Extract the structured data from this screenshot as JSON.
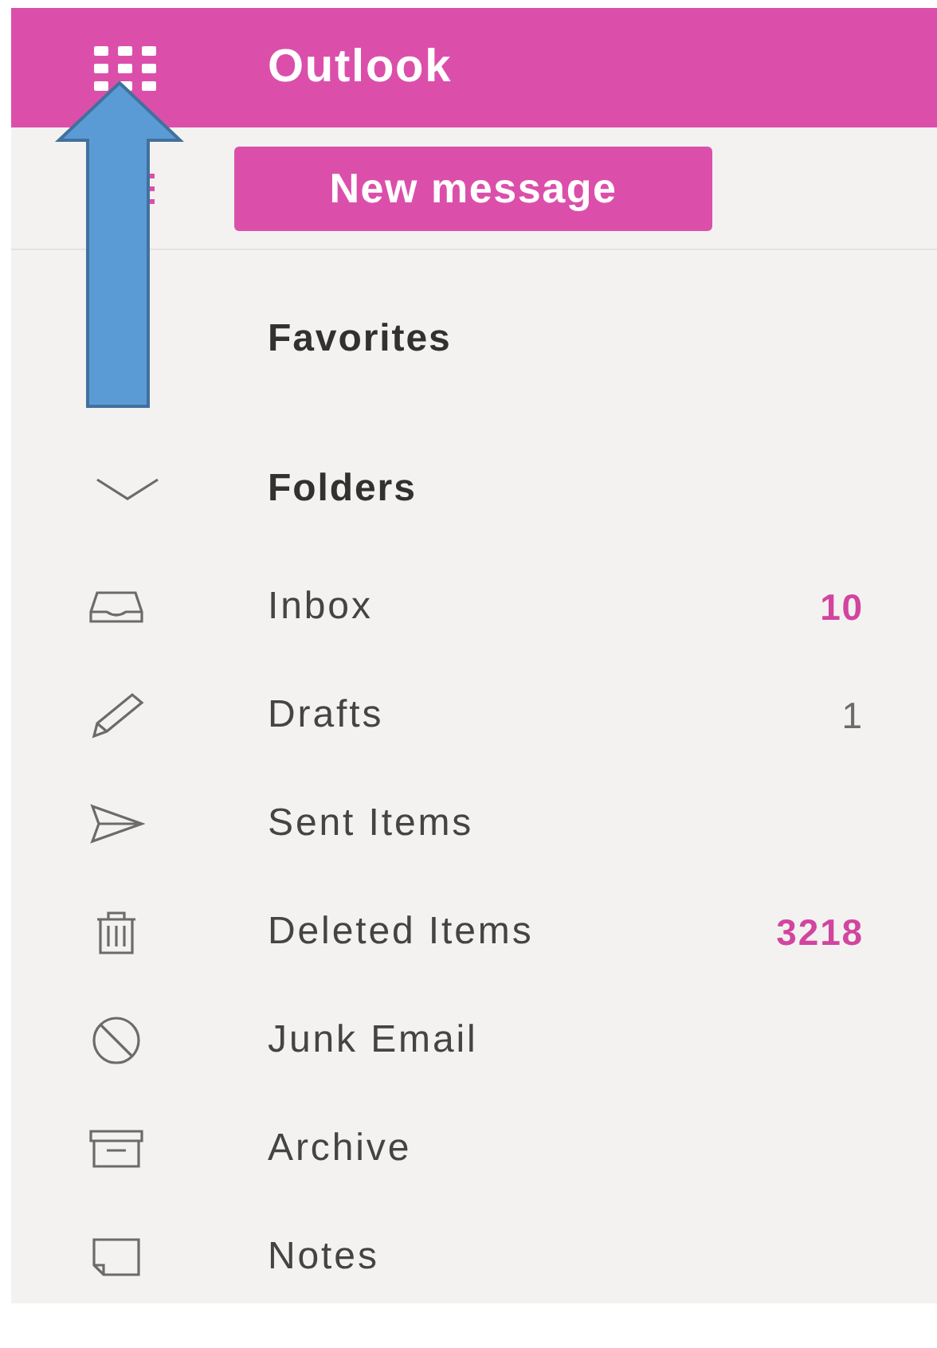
{
  "header": {
    "title": "Outlook"
  },
  "new_message_button": {
    "label": "New message"
  },
  "sections": [
    {
      "label": "Favorites"
    },
    {
      "label": "Folders",
      "expanded": true
    }
  ],
  "folders": [
    {
      "kind": "inbox",
      "name": "Inbox",
      "count": "10",
      "unread": true
    },
    {
      "kind": "drafts",
      "name": "Drafts",
      "count": "1",
      "unread": false
    },
    {
      "kind": "sent",
      "name": "Sent Items"
    },
    {
      "kind": "deleted",
      "name": "Deleted Items",
      "count": "3218",
      "unread": true
    },
    {
      "kind": "junk",
      "name": "Junk Email"
    },
    {
      "kind": "archive",
      "name": "Archive"
    },
    {
      "kind": "notes",
      "name": "Notes"
    }
  ]
}
